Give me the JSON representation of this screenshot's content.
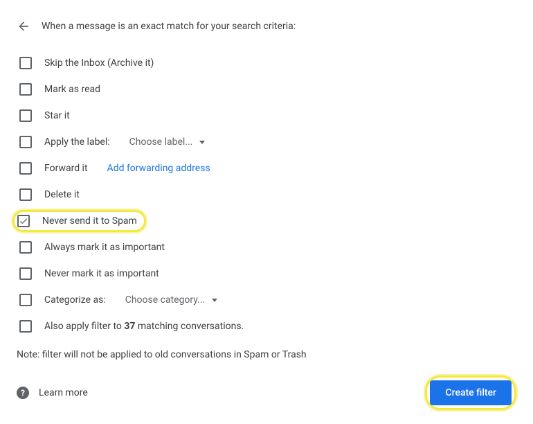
{
  "header": {
    "title": "When a message is an exact match for your search criteria:"
  },
  "options": {
    "skip_inbox": {
      "label": "Skip the Inbox (Archive it)",
      "checked": false
    },
    "mark_read": {
      "label": "Mark as read",
      "checked": false
    },
    "star": {
      "label": "Star it",
      "checked": false
    },
    "apply_label": {
      "label": "Apply the label:",
      "checked": false,
      "dropdown": "Choose label..."
    },
    "forward": {
      "label": "Forward it",
      "checked": false,
      "link": "Add forwarding address"
    },
    "delete": {
      "label": "Delete it",
      "checked": false
    },
    "never_spam": {
      "label": "Never send it to Spam",
      "checked": true
    },
    "always_important": {
      "label": "Always mark it as important",
      "checked": false
    },
    "never_important": {
      "label": "Never mark it as important",
      "checked": false
    },
    "categorize": {
      "label": "Categorize as:",
      "checked": false,
      "dropdown": "Choose category..."
    },
    "also_apply": {
      "prefix": "Also apply filter to ",
      "count": "37",
      "suffix": " matching conversations.",
      "checked": false
    }
  },
  "note": "Note: filter will not be applied to old conversations in Spam or Trash",
  "footer": {
    "learn_more": "Learn more",
    "create_filter": "Create filter"
  }
}
